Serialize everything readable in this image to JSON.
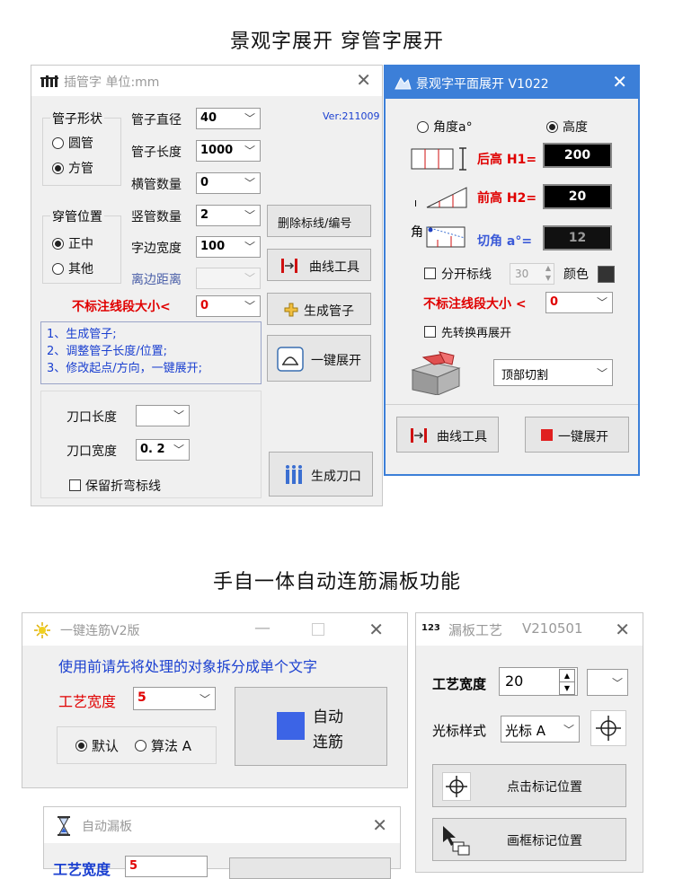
{
  "headings": {
    "top": "景观字展开  穿管字展开",
    "middle": "手自一体自动连筋漏板功能"
  },
  "pipe_window": {
    "title": "插管字 单位:mm",
    "version": "Ver:211009",
    "shape_group": {
      "label": "管子形状",
      "options": [
        "圆管",
        "方管"
      ],
      "selected": "方管"
    },
    "position_group": {
      "label": "穿管位置",
      "options": [
        "正中",
        "其他"
      ],
      "selected": "正中"
    },
    "fields": [
      {
        "label": "管子直径",
        "value": "40"
      },
      {
        "label": "管子长度",
        "value": "1000"
      },
      {
        "label": "横管数量",
        "value": "0"
      },
      {
        "label": "竖管数量",
        "value": "2"
      },
      {
        "label": "字边宽度",
        "value": "100"
      },
      {
        "label": "离边距离",
        "value": ""
      }
    ],
    "min_segment_label": "不标注线段大小<",
    "min_segment_value": "0",
    "buttons": {
      "delete_marks": "删除标线/编号",
      "curve_tool": "曲线工具",
      "generate_pipe": "生成管子",
      "one_key_unfold": "一键展开",
      "generate_notch": "生成刀口"
    },
    "steps": [
      "1、生成管子;",
      "2、调整管子长度/位置;",
      "3、修改起点/方向，一键展开;"
    ],
    "notch_length_label": "刀口长度",
    "notch_length_value": "",
    "notch_width_label": "刀口宽度",
    "notch_width_value": "0. 2",
    "keep_fold_label": "保留折弯标线"
  },
  "landscape_window": {
    "title": "景观字平面展开 V1022",
    "mode_options": [
      "角度a°",
      "高度"
    ],
    "mode_selected": "高度",
    "rows": [
      {
        "label": "后高 H1=",
        "value": "200"
      },
      {
        "label": "前高 H2=",
        "value": "20"
      },
      {
        "label": "切角 a°=",
        "value": "12"
      }
    ],
    "small_labels": {
      "angle_mark": "角",
      "i_mark_1": "I",
      "i_mark_2": "I"
    },
    "split_label": "分开标线",
    "split_value": "30",
    "color_label": "颜色",
    "color_value": "#333333",
    "min_segment_label": "不标注线段大小 <",
    "min_segment_value": "0",
    "convert_first_label": "先转换再展开",
    "cut_mode_value": "顶部切割",
    "buttons": {
      "curve_tool": "曲线工具",
      "one_key_unfold": "一键展开"
    },
    "accent_color": "#3c7fd8"
  },
  "rebar_window": {
    "title": "一键连筋V2版",
    "notice": "使用前请先将处理的对象拆分成单个文字",
    "width_label": "工艺宽度",
    "width_value": "5",
    "algo_options": [
      "默认",
      "算法 A"
    ],
    "algo_selected": "默认",
    "button_line1": "自动",
    "button_line2": "连筋",
    "button_color": "#3c64e6"
  },
  "leak_window": {
    "title": "漏板工艺",
    "version": "V210501",
    "width_label": "工艺宽度",
    "width_value": "20",
    "cursor_label": "光标样式",
    "cursor_value": "光标 A",
    "click_mark_button": "点击标记位置",
    "frame_mark_button": "画框标记位置",
    "title_icon_text": "123"
  },
  "auto_leak_window": {
    "title": "自动漏板",
    "width_label": "工艺宽度",
    "width_value": "5"
  }
}
